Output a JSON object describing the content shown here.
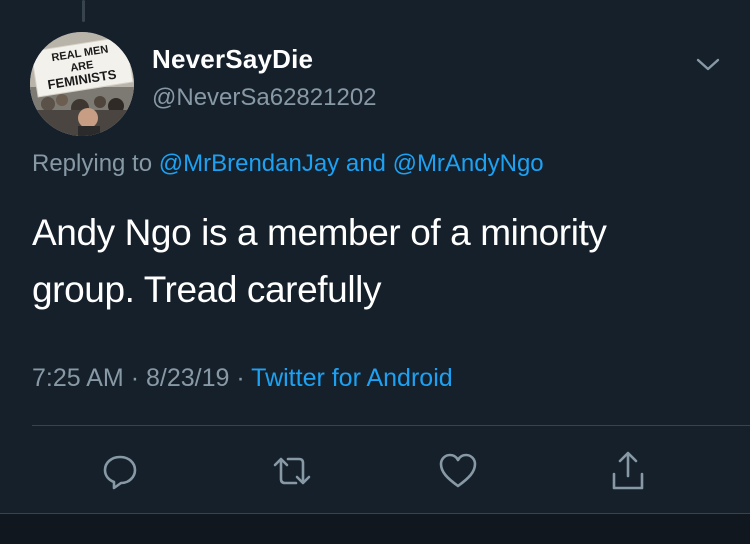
{
  "avatar": {
    "sign_lines": [
      "REAL MEN",
      "ARE",
      "FEMINISTS"
    ]
  },
  "user": {
    "display_name": "NeverSayDie",
    "handle": "@NeverSa62821202"
  },
  "reply": {
    "prefix": "Replying to",
    "mention_1": "@MrBrendanJay",
    "joiner": "and",
    "mention_2": "@MrAndyNgo"
  },
  "tweet": {
    "line_1": "Andy Ngo is a member of a minority",
    "line_2": "group. Tread carefully"
  },
  "meta": {
    "time": "7:25 AM",
    "separator": "·",
    "date": "8/23/19",
    "source": "Twitter for Android"
  },
  "icons": {
    "more": "chevron-down-icon",
    "reply": "speech-bubble-icon",
    "retweet": "retweet-icon",
    "like": "heart-icon",
    "share": "share-icon"
  },
  "colors": {
    "background": "#15202b",
    "text": "#ffffff",
    "secondary": "#8899a6",
    "link": "#1da1f2",
    "divider": "#38444d"
  }
}
